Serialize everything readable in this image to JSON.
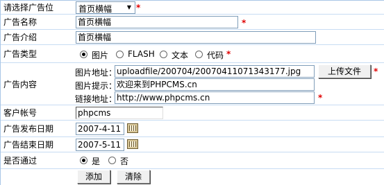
{
  "form": {
    "position": {
      "label": "请选择广告位",
      "value": "首页横幅"
    },
    "name": {
      "label": "广告名称",
      "value": "首页横幅"
    },
    "intro": {
      "label": "广告介绍",
      "value": "首页横幅"
    },
    "type": {
      "label": "广告类型",
      "options": [
        "图片",
        "FLASH",
        "文本",
        "代码"
      ],
      "selected": "图片"
    },
    "content": {
      "label": "广告内容",
      "image_url_label": "图片地址：",
      "image_url_value": "uploadfile/200704/20070411071343177.jpg",
      "upload_button": "上传文件",
      "image_tip_label": "图片提示：",
      "image_tip_value": "欢迎来到PHPCMS.cn",
      "link_label": "链接地址：",
      "link_value": "http://www.phpcms.cn"
    },
    "account": {
      "label": "客户帐号",
      "value": "phpcms"
    },
    "start_date": {
      "label": "广告发布日期",
      "value": "2007-4-11"
    },
    "end_date": {
      "label": "广告结束日期",
      "value": "2007-5-11"
    },
    "approved": {
      "label": "是否通过",
      "options": [
        "是",
        "否"
      ],
      "selected": "是"
    },
    "submit_button": "添加",
    "reset_button": "清除",
    "required_mark": "*"
  },
  "colors": {
    "required": "#e00000",
    "border": "#a9c6e6"
  }
}
